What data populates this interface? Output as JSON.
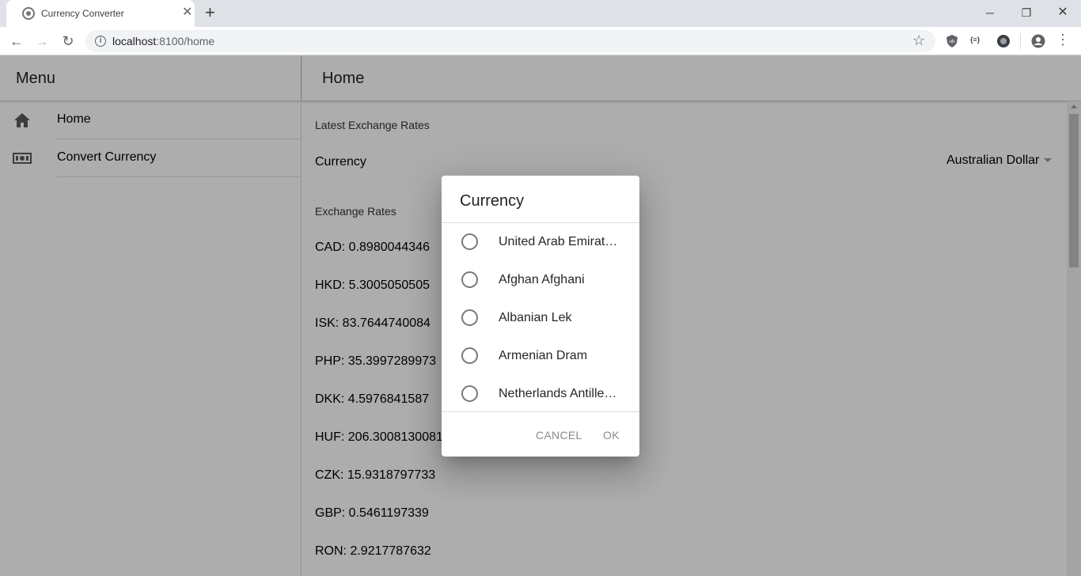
{
  "browser": {
    "tab_title": "Currency Converter",
    "url_host": "localhost",
    "url_path": ":8100/home",
    "ext_text": "{≡}"
  },
  "menu": {
    "title": "Menu",
    "items": [
      {
        "label": "Home",
        "icon": "home-icon"
      },
      {
        "label": "Convert Currency",
        "icon": "cash-icon"
      }
    ]
  },
  "page": {
    "title": "Home",
    "latest_label": "Latest Exchange Rates",
    "currency_label": "Currency",
    "currency_value": "Australian Dollar",
    "rates_label": "Exchange Rates",
    "rates": [
      "CAD: 0.8980044346",
      "HKD: 5.3005050505",
      "ISK: 83.7644740084",
      "PHP: 35.3997289973",
      "DKK: 4.5976841587",
      "HUF: 206.3008130081",
      "CZK: 15.9318797733",
      "GBP: 0.5461197339",
      "RON: 2.9217787632"
    ]
  },
  "dialog": {
    "title": "Currency",
    "options": [
      "United Arab Emirates Dirham",
      "Afghan Afghani",
      "Albanian Lek",
      "Armenian Dram",
      "Netherlands Antillean Guilder"
    ],
    "cancel_label": "CANCEL",
    "ok_label": "OK"
  }
}
